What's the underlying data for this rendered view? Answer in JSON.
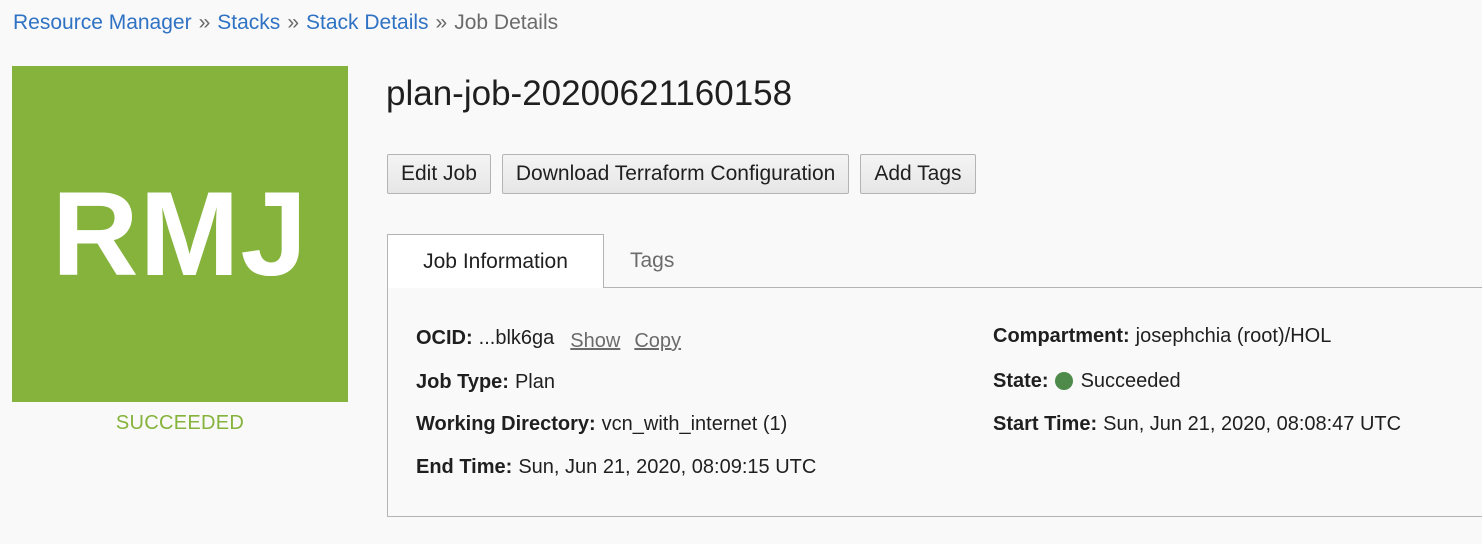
{
  "breadcrumb": {
    "items": [
      "Resource Manager",
      "Stacks",
      "Stack Details"
    ],
    "separator": "»",
    "current": "Job Details"
  },
  "logo": {
    "text": "RMJ",
    "color": "#85b33b"
  },
  "status": {
    "label": "SUCCEEDED",
    "color": "#85b33b"
  },
  "title": "plan-job-20200621160158",
  "actions": {
    "edit_job": "Edit Job",
    "download_config": "Download Terraform Configuration",
    "add_tags": "Add Tags"
  },
  "tabs": {
    "job_information": "Job Information",
    "tags": "Tags"
  },
  "details": {
    "ocid_label": "OCID:",
    "ocid_value": "...blk6ga",
    "ocid_show": "Show",
    "ocid_copy": "Copy",
    "job_type_label": "Job Type:",
    "job_type_value": "Plan",
    "working_dir_label": "Working Directory:",
    "working_dir_value": "vcn_with_internet (1)",
    "end_time_label": "End Time:",
    "end_time_value": "Sun, Jun 21, 2020, 08:09:15 UTC",
    "compartment_label": "Compartment:",
    "compartment_value": "josephchia (root)/HOL",
    "state_label": "State:",
    "state_value": "Succeeded",
    "state_color": "#4e8a4a",
    "start_time_label": "Start Time:",
    "start_time_value": "Sun, Jun 21, 2020, 08:08:47 UTC"
  }
}
